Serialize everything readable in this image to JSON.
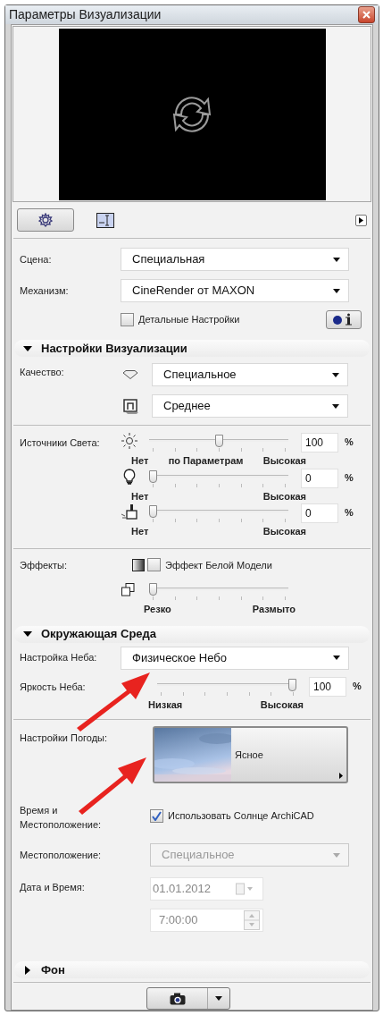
{
  "window": {
    "title": "Параметры Визуализации"
  },
  "toolbar": {
    "tabs": [
      {
        "selected": true
      },
      {
        "selected": false
      }
    ]
  },
  "scene": {
    "label": "Сцена:",
    "value": "Специальная"
  },
  "engine": {
    "label": "Механизм:",
    "value": "CineRender от MAXON"
  },
  "detailed": {
    "label": "Детальные Настройки",
    "checked": false
  },
  "render_settings": {
    "title": "Настройки Визуализации",
    "expanded": true,
    "quality_label": "Качество:",
    "quality": "Специальное",
    "detail": "Среднее"
  },
  "lights": {
    "label": "Источники Света:",
    "sliders": [
      {
        "level": 0.5,
        "value": "100",
        "unit": "%",
        "ticks": [
          "Нет",
          "по Параметрам",
          "Высокая"
        ]
      },
      {
        "level": 0,
        "value": "0",
        "unit": "%",
        "ticks": [
          "Нет",
          "Высокая"
        ]
      },
      {
        "level": 0,
        "value": "0",
        "unit": "%",
        "ticks": [
          "Нет",
          "Высокая"
        ]
      }
    ]
  },
  "effects": {
    "label": "Эффекты:",
    "white_model": {
      "label": "Эффект Белой Модели",
      "checked": false
    },
    "blur": {
      "level": 0,
      "ticks": [
        "Резко",
        "Размыто"
      ]
    }
  },
  "environment": {
    "title": "Окружающая Среда",
    "expanded": true,
    "sky_label": "Настройка Неба:",
    "sky": "Физическое Небо",
    "brightness": {
      "label": "Яркость Неба:",
      "level": 1,
      "value": "100",
      "unit": "%",
      "ticks": [
        "Низкая",
        "Высокая"
      ]
    },
    "weather_label": "Настройки Погоды:",
    "weather": "Ясное",
    "time_label": "Время и Местоположение:",
    "use_sun": {
      "label": "Использовать Солнце ArchiCAD",
      "checked": true
    },
    "location_label": "Местоположение:",
    "location": {
      "value": "Специальное",
      "disabled": true
    },
    "date_label": "Дата и Время:",
    "date": "01.01.2012",
    "time": "7:00:00"
  },
  "background": {
    "title": "Фон",
    "expanded": false
  }
}
